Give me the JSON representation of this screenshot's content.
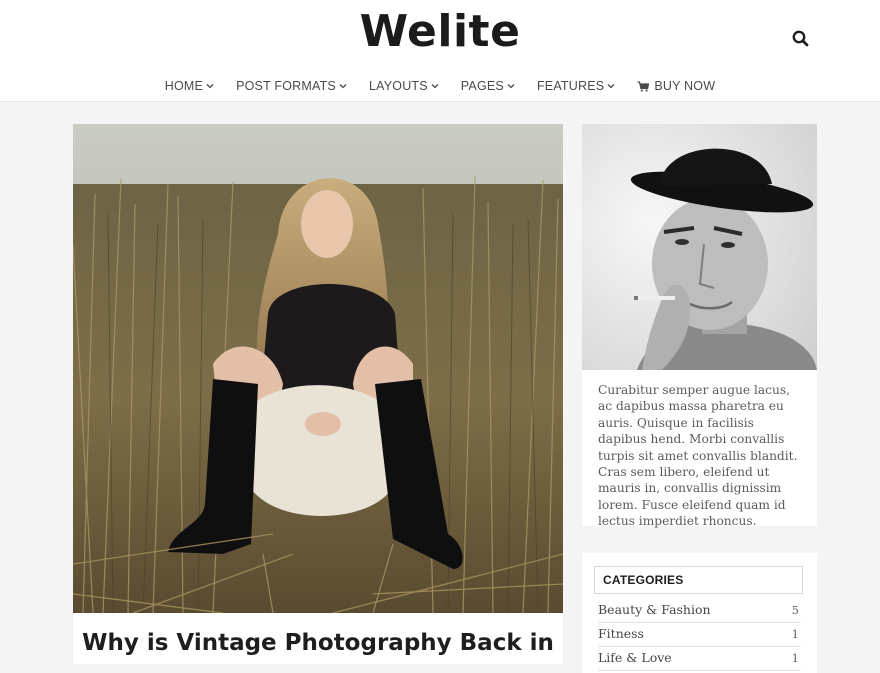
{
  "site": {
    "logo": "Welite",
    "search_icon": "search-icon"
  },
  "nav": {
    "items": [
      {
        "label": "HOME",
        "icon": "chevron-down-icon"
      },
      {
        "label": "POST FORMATS",
        "icon": "chevron-down-icon"
      },
      {
        "label": "LAYOUTS",
        "icon": "chevron-down-icon"
      },
      {
        "label": "PAGES",
        "icon": "chevron-down-icon"
      },
      {
        "label": "FEATURES",
        "icon": "chevron-down-icon"
      },
      {
        "label": "BUY NOW",
        "icon": "cart-icon"
      }
    ]
  },
  "post": {
    "title": "Why is Vintage Photography Back in"
  },
  "about": {
    "text": "Curabitur semper augue lacus, ac dapibus massa pharetra eu auris. Quisque in facilisis dapibus hend. Morbi convallis turpis sit amet convallis blandit. Cras sem libero, eleifend ut mauris in, convallis dignissim lorem. Fusce eleifend quam id lectus imperdiet rhoncus."
  },
  "categories": {
    "title": "CATEGORIES",
    "items": [
      {
        "name": "Beauty & Fashion",
        "count": "5"
      },
      {
        "name": "Fitness",
        "count": "1"
      },
      {
        "name": "Life & Love",
        "count": "1"
      }
    ]
  },
  "colors": {
    "background": "#f4f4f4",
    "header": "#ffffff",
    "text_dark": "#1e1e1e"
  }
}
